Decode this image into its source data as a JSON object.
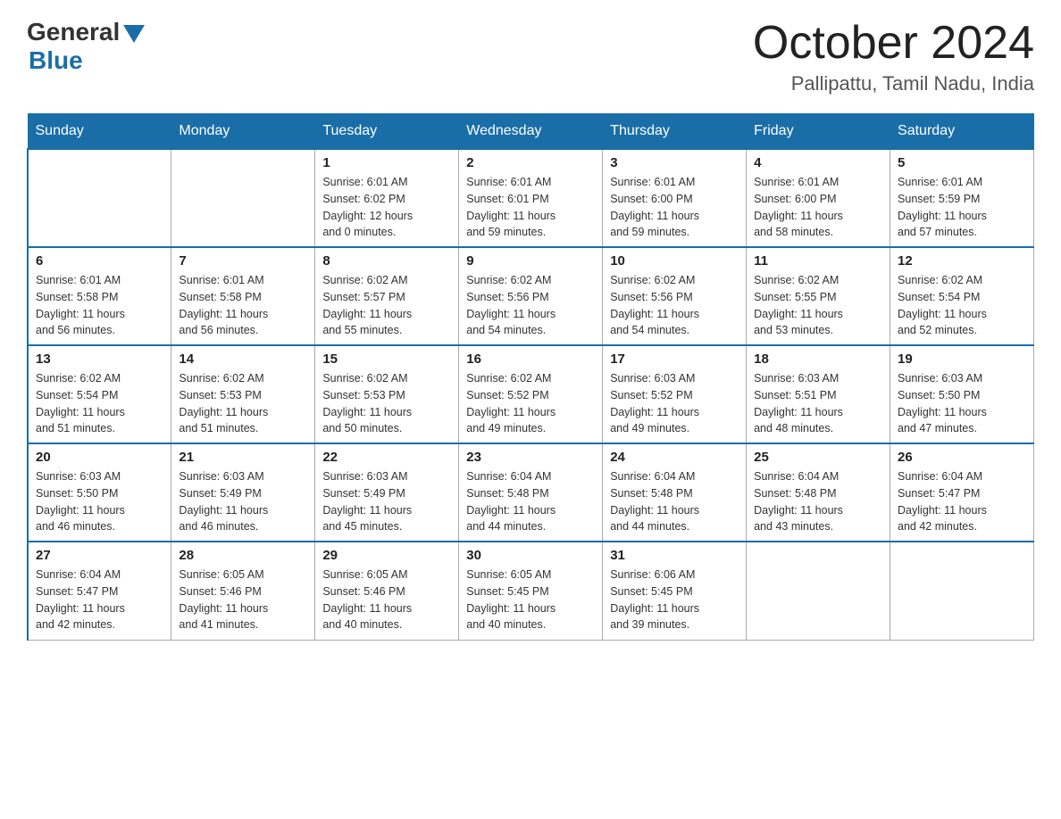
{
  "logo": {
    "general": "General",
    "blue": "Blue"
  },
  "title": "October 2024",
  "subtitle": "Pallipattu, Tamil Nadu, India",
  "days": [
    "Sunday",
    "Monday",
    "Tuesday",
    "Wednesday",
    "Thursday",
    "Friday",
    "Saturday"
  ],
  "weeks": [
    [
      {
        "date": "",
        "info": ""
      },
      {
        "date": "",
        "info": ""
      },
      {
        "date": "1",
        "info": "Sunrise: 6:01 AM\nSunset: 6:02 PM\nDaylight: 12 hours\nand 0 minutes."
      },
      {
        "date": "2",
        "info": "Sunrise: 6:01 AM\nSunset: 6:01 PM\nDaylight: 11 hours\nand 59 minutes."
      },
      {
        "date": "3",
        "info": "Sunrise: 6:01 AM\nSunset: 6:00 PM\nDaylight: 11 hours\nand 59 minutes."
      },
      {
        "date": "4",
        "info": "Sunrise: 6:01 AM\nSunset: 6:00 PM\nDaylight: 11 hours\nand 58 minutes."
      },
      {
        "date": "5",
        "info": "Sunrise: 6:01 AM\nSunset: 5:59 PM\nDaylight: 11 hours\nand 57 minutes."
      }
    ],
    [
      {
        "date": "6",
        "info": "Sunrise: 6:01 AM\nSunset: 5:58 PM\nDaylight: 11 hours\nand 56 minutes."
      },
      {
        "date": "7",
        "info": "Sunrise: 6:01 AM\nSunset: 5:58 PM\nDaylight: 11 hours\nand 56 minutes."
      },
      {
        "date": "8",
        "info": "Sunrise: 6:02 AM\nSunset: 5:57 PM\nDaylight: 11 hours\nand 55 minutes."
      },
      {
        "date": "9",
        "info": "Sunrise: 6:02 AM\nSunset: 5:56 PM\nDaylight: 11 hours\nand 54 minutes."
      },
      {
        "date": "10",
        "info": "Sunrise: 6:02 AM\nSunset: 5:56 PM\nDaylight: 11 hours\nand 54 minutes."
      },
      {
        "date": "11",
        "info": "Sunrise: 6:02 AM\nSunset: 5:55 PM\nDaylight: 11 hours\nand 53 minutes."
      },
      {
        "date": "12",
        "info": "Sunrise: 6:02 AM\nSunset: 5:54 PM\nDaylight: 11 hours\nand 52 minutes."
      }
    ],
    [
      {
        "date": "13",
        "info": "Sunrise: 6:02 AM\nSunset: 5:54 PM\nDaylight: 11 hours\nand 51 minutes."
      },
      {
        "date": "14",
        "info": "Sunrise: 6:02 AM\nSunset: 5:53 PM\nDaylight: 11 hours\nand 51 minutes."
      },
      {
        "date": "15",
        "info": "Sunrise: 6:02 AM\nSunset: 5:53 PM\nDaylight: 11 hours\nand 50 minutes."
      },
      {
        "date": "16",
        "info": "Sunrise: 6:02 AM\nSunset: 5:52 PM\nDaylight: 11 hours\nand 49 minutes."
      },
      {
        "date": "17",
        "info": "Sunrise: 6:03 AM\nSunset: 5:52 PM\nDaylight: 11 hours\nand 49 minutes."
      },
      {
        "date": "18",
        "info": "Sunrise: 6:03 AM\nSunset: 5:51 PM\nDaylight: 11 hours\nand 48 minutes."
      },
      {
        "date": "19",
        "info": "Sunrise: 6:03 AM\nSunset: 5:50 PM\nDaylight: 11 hours\nand 47 minutes."
      }
    ],
    [
      {
        "date": "20",
        "info": "Sunrise: 6:03 AM\nSunset: 5:50 PM\nDaylight: 11 hours\nand 46 minutes."
      },
      {
        "date": "21",
        "info": "Sunrise: 6:03 AM\nSunset: 5:49 PM\nDaylight: 11 hours\nand 46 minutes."
      },
      {
        "date": "22",
        "info": "Sunrise: 6:03 AM\nSunset: 5:49 PM\nDaylight: 11 hours\nand 45 minutes."
      },
      {
        "date": "23",
        "info": "Sunrise: 6:04 AM\nSunset: 5:48 PM\nDaylight: 11 hours\nand 44 minutes."
      },
      {
        "date": "24",
        "info": "Sunrise: 6:04 AM\nSunset: 5:48 PM\nDaylight: 11 hours\nand 44 minutes."
      },
      {
        "date": "25",
        "info": "Sunrise: 6:04 AM\nSunset: 5:48 PM\nDaylight: 11 hours\nand 43 minutes."
      },
      {
        "date": "26",
        "info": "Sunrise: 6:04 AM\nSunset: 5:47 PM\nDaylight: 11 hours\nand 42 minutes."
      }
    ],
    [
      {
        "date": "27",
        "info": "Sunrise: 6:04 AM\nSunset: 5:47 PM\nDaylight: 11 hours\nand 42 minutes."
      },
      {
        "date": "28",
        "info": "Sunrise: 6:05 AM\nSunset: 5:46 PM\nDaylight: 11 hours\nand 41 minutes."
      },
      {
        "date": "29",
        "info": "Sunrise: 6:05 AM\nSunset: 5:46 PM\nDaylight: 11 hours\nand 40 minutes."
      },
      {
        "date": "30",
        "info": "Sunrise: 6:05 AM\nSunset: 5:45 PM\nDaylight: 11 hours\nand 40 minutes."
      },
      {
        "date": "31",
        "info": "Sunrise: 6:06 AM\nSunset: 5:45 PM\nDaylight: 11 hours\nand 39 minutes."
      },
      {
        "date": "",
        "info": ""
      },
      {
        "date": "",
        "info": ""
      }
    ]
  ]
}
